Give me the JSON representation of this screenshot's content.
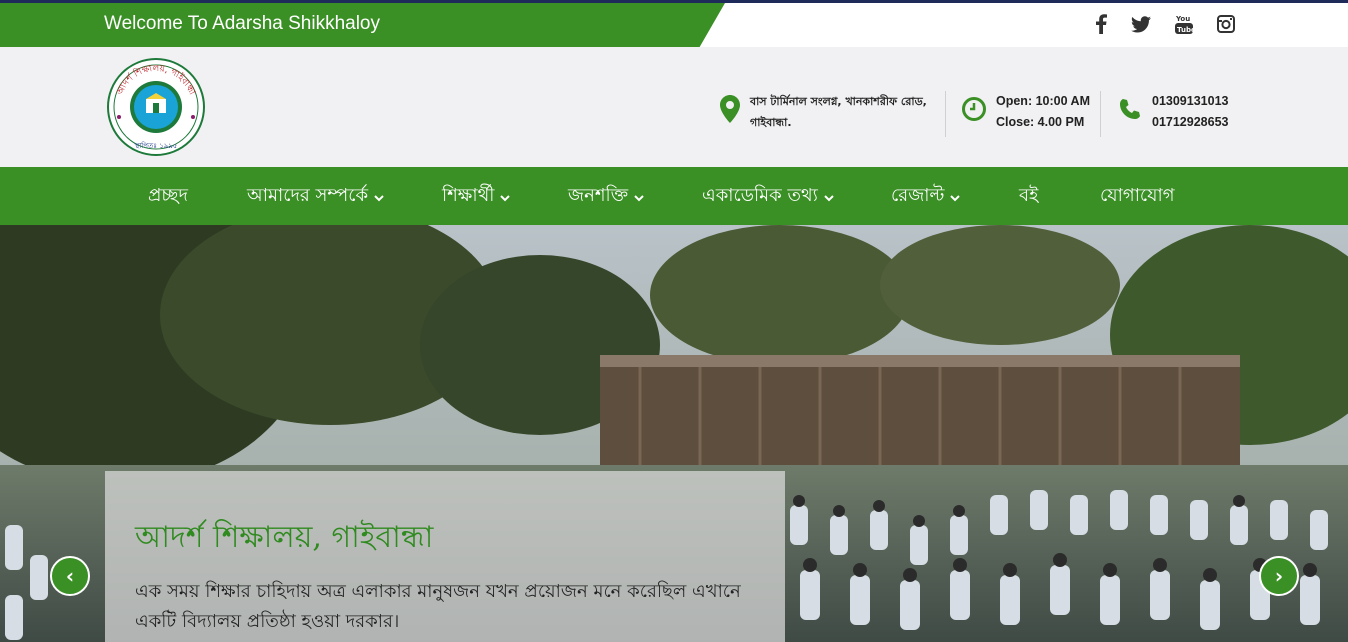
{
  "topbar": {
    "welcome": "Welcome To Adarsha Shikkhaloy",
    "social": [
      "facebook-icon",
      "twitter-icon",
      "youtube-icon",
      "instagram-icon"
    ]
  },
  "header": {
    "logo": {
      "name": "আদর্শ শিক্ষালয়, গাইবান্ধা",
      "established": "স্থাপিতঃ ১৯৯৫"
    },
    "address": {
      "line1": "বাস টার্মিনাল সংলগ্ন, খানকাশরীফ রোড,",
      "line2": "গাইবান্ধা."
    },
    "hours": {
      "open": "Open: 10:00 AM",
      "close": "Close: 4.00 PM"
    },
    "phones": {
      "phone1": "01309131013",
      "phone2": "01712928653"
    }
  },
  "nav": {
    "items": [
      {
        "label": "প্রচ্ছদ",
        "dropdown": false
      },
      {
        "label": "আমাদের সম্পর্কে",
        "dropdown": true
      },
      {
        "label": "শিক্ষার্থী",
        "dropdown": true
      },
      {
        "label": "জনশক্তি",
        "dropdown": true
      },
      {
        "label": "একাডেমিক তথ্য",
        "dropdown": true
      },
      {
        "label": "রেজাল্ট",
        "dropdown": true
      },
      {
        "label": "বই",
        "dropdown": false
      },
      {
        "label": "যোগাযোগ",
        "dropdown": false
      }
    ]
  },
  "hero": {
    "title": "আদর্শ শিক্ষালয়, গাইবান্ধা",
    "text": "এক সময় শিক্ষার চাহিদায় অত্র এলাকার মানুষজন যখন প্রয়োজন মনে করেছিল এখানে একটি বিদ্যালয় প্রতিষ্ঠা হওয়া দরকার।",
    "prev": "‹",
    "next": "›"
  },
  "colors": {
    "brand_green": "#3a8f25",
    "topbar_border": "#1e2a5a",
    "header_bg": "#f1f1f3"
  }
}
